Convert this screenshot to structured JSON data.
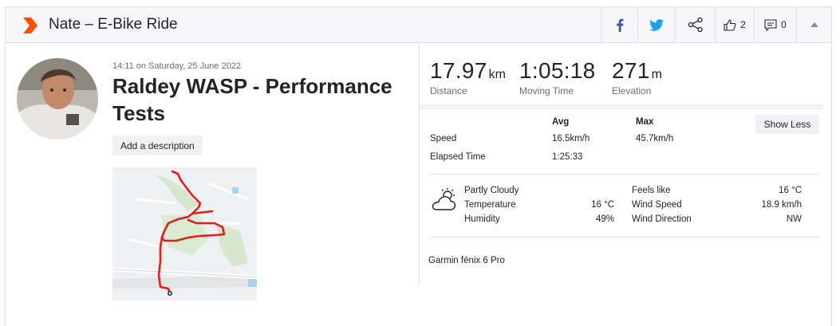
{
  "header": {
    "title": "Nate – E-Bike Ride",
    "kudos_count": "2",
    "comment_count": "0"
  },
  "activity": {
    "timestamp": "14:11 on Saturday, 25 June 2022",
    "name": "Raldey WASP - Performance Tests",
    "add_description_label": "Add a description"
  },
  "stats": {
    "distance": {
      "value": "17.97",
      "unit": "km",
      "label": "Distance"
    },
    "moving_time": {
      "value": "1:05:18",
      "label": "Moving Time"
    },
    "elevation": {
      "value": "271",
      "unit": "m",
      "label": "Elevation"
    }
  },
  "details": {
    "col_avg": "Avg",
    "col_max": "Max",
    "show_less_label": "Show Less",
    "speed_label": "Speed",
    "speed_avg": "16.5km/h",
    "speed_max": "45.7km/h",
    "elapsed_label": "Elapsed Time",
    "elapsed_value": "1:25:33"
  },
  "weather": {
    "condition": "Partly Cloudy",
    "temperature_label": "Temperature",
    "temperature_value": "16 °C",
    "humidity_label": "Humidity",
    "humidity_value": "49%",
    "feels_like_label": "Feels like",
    "feels_like_value": "16 °C",
    "wind_speed_label": "Wind Speed",
    "wind_speed_value": "18.9 km/h",
    "wind_direction_label": "Wind Direction",
    "wind_direction_value": "NW"
  },
  "device": "Garmin fēnix 6 Pro",
  "colors": {
    "brand": "#fc5200",
    "facebook": "#3b5998",
    "twitter": "#1da1f2",
    "route": "#e0201c"
  },
  "icons": [
    "sport-chevron-icon",
    "facebook-icon",
    "twitter-icon",
    "share-icon",
    "thumbs-up-icon",
    "comment-icon",
    "caret-up-icon",
    "partly-cloudy-icon"
  ]
}
